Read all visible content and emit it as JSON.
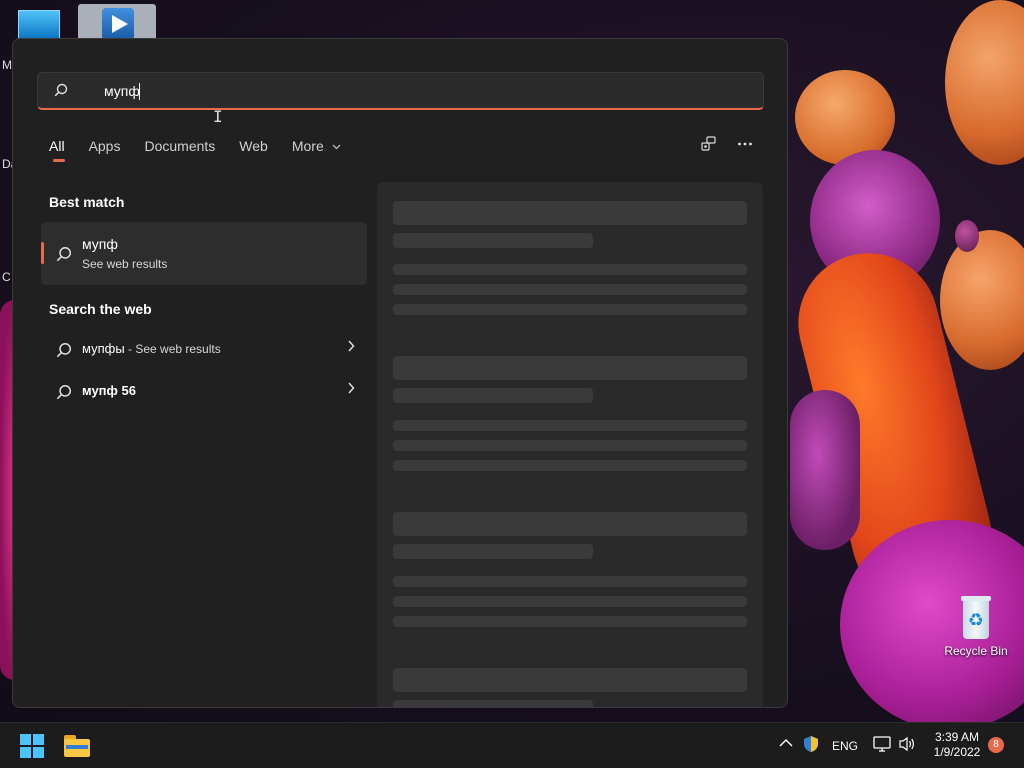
{
  "search": {
    "query": "мупф",
    "placeholder": ""
  },
  "tabs": [
    {
      "label": "All",
      "active": true
    },
    {
      "label": "Apps",
      "active": false
    },
    {
      "label": "Documents",
      "active": false
    },
    {
      "label": "Web",
      "active": false
    },
    {
      "label": "More",
      "active": false
    }
  ],
  "toolbar": {
    "icons": [
      "share-device-icon",
      "more-options-icon"
    ]
  },
  "best_match": {
    "section_title": "Best match",
    "title": "мупф",
    "subtitle": "See web results",
    "icon": "search-icon"
  },
  "search_web": {
    "section_title": "Search the web",
    "items": [
      {
        "query": "мупфы",
        "suffix": " - See web results",
        "icon": "search-icon"
      },
      {
        "query": "мупф 56",
        "suffix": "",
        "icon": "search-icon"
      }
    ]
  },
  "desktop": {
    "recycle_bin_label": "Recycle Bin",
    "edge_letters": [
      "M",
      "Da",
      "C"
    ]
  },
  "taskbar": {
    "language": "ENG",
    "time": "3:39 AM",
    "date": "1/9/2022",
    "notification_count": "8"
  },
  "colors": {
    "accent": "#e86a4c",
    "panel_bg": "#202020",
    "taskbar_bg": "#1c1c1c"
  }
}
